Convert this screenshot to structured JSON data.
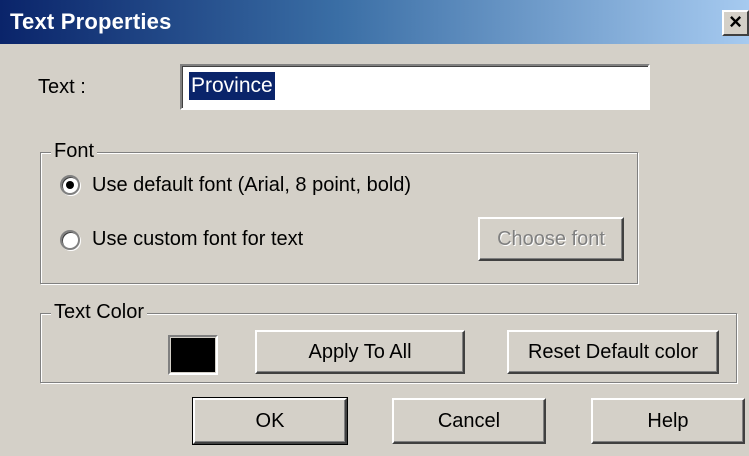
{
  "dialog": {
    "title": "Text Properties",
    "close_glyph": "×",
    "close_icon": "close-icon"
  },
  "text_field": {
    "label": "Text :",
    "value": "Province"
  },
  "font_group": {
    "caption": "Font",
    "option_default": "Use default font (Arial, 8 point, bold)",
    "option_custom": "Use custom font for text",
    "selected": "default",
    "choose_font_label": "Choose font"
  },
  "color_group": {
    "caption": "Text Color",
    "swatch_color": "#000000",
    "apply_all_label": "Apply To All",
    "reset_label": "Reset Default color"
  },
  "buttons": {
    "ok": "OK",
    "cancel": "Cancel",
    "help": "Help"
  },
  "colors": {
    "face": "#d4d0c8",
    "titlebar_start": "#0a246a",
    "titlebar_end": "#a6caf0",
    "selection": "#0a246a"
  }
}
